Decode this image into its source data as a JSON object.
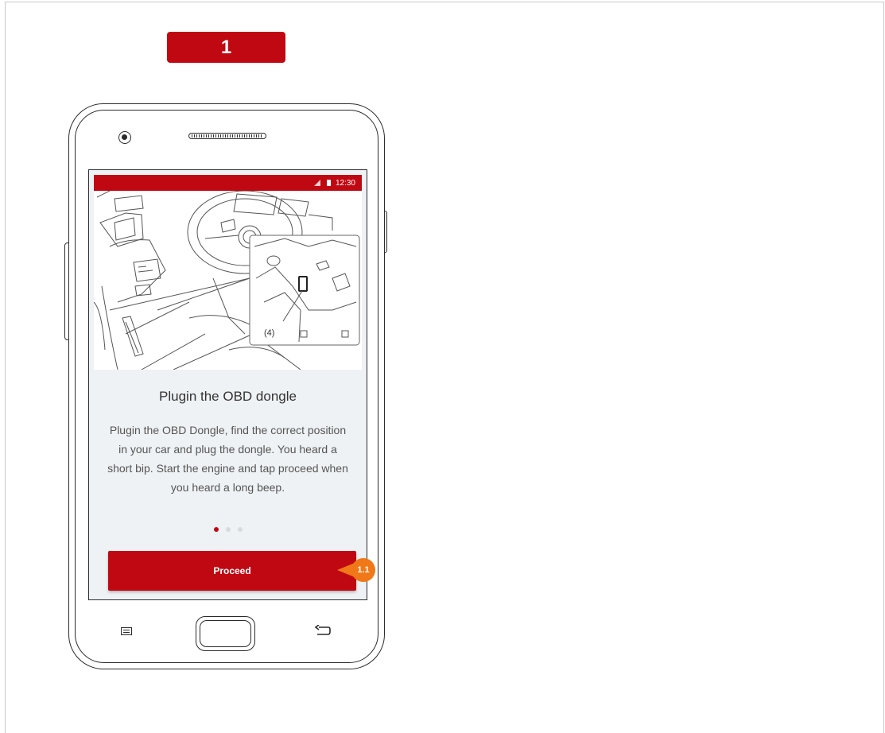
{
  "step_badge": "1",
  "status_bar": {
    "time": "12:30"
  },
  "illustration": {
    "callout_label": "(4)"
  },
  "card": {
    "title": "Plugin the OBD dongle",
    "description": "Plugin the OBD Dongle, find the correct position in your car and plug the dongle. You heard a short bip. Start the engine and tap proceed when you heard a long beep.",
    "pagination": {
      "total": 3,
      "active_index": 0
    },
    "proceed_label": "Proceed"
  },
  "annotation": {
    "label": "1.1"
  },
  "colors": {
    "brand_red": "#c00813",
    "annotation_orange": "#f07818",
    "card_bg": "#eff2f5"
  },
  "icons": [
    "camera-icon",
    "speaker-grille-icon",
    "signal-icon",
    "battery-icon",
    "menu-icon",
    "home-button",
    "back-icon"
  ]
}
